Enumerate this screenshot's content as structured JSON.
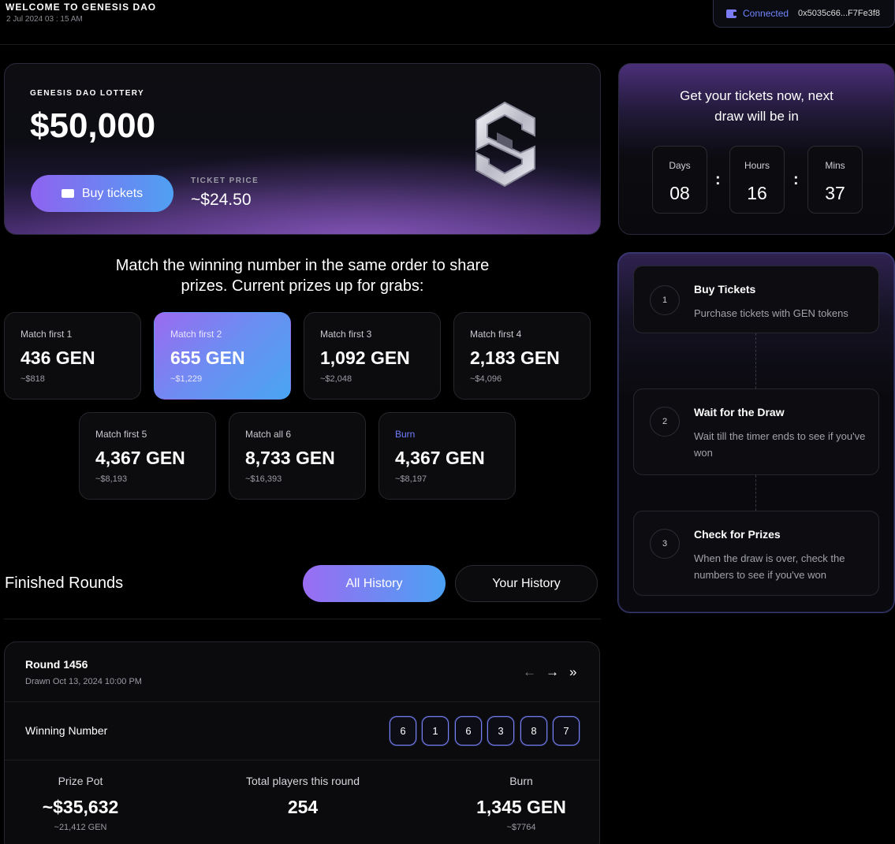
{
  "header": {
    "welcome": "WELCOME TO GENESIS DAO",
    "datetime": "2 Jul 2024  03 : 15 AM",
    "wallet_status": "Connected",
    "wallet_address": "0x5035c66...F7Fe3f8"
  },
  "hero": {
    "label": "GENESIS DAO LOTTERY",
    "amount": "$50,000",
    "buy_label": "Buy tickets",
    "ticket_price_label": "TICKET PRICE",
    "ticket_price": "~$24.50"
  },
  "countdown": {
    "title_line1": "Get your tickets now, next",
    "title_line2": "draw will be in",
    "days_label": "Days",
    "days": "08",
    "hours_label": "Hours",
    "hours": "16",
    "mins_label": "Mins",
    "mins": "37",
    "separator": ":"
  },
  "match": {
    "title_line1": "Match the winning number in the same order to share",
    "title_line2": "prizes. Current prizes up for grabs:"
  },
  "prizes": [
    {
      "label": "Match first 1",
      "value": "436 GEN",
      "usd": "~$818"
    },
    {
      "label": "Match first 2",
      "value": "655 GEN",
      "usd": "~$1,229"
    },
    {
      "label": "Match first 3",
      "value": "1,092 GEN",
      "usd": "~$2,048"
    },
    {
      "label": "Match first 4",
      "value": "2,183 GEN",
      "usd": "~$4,096"
    },
    {
      "label": "Match first 5",
      "value": "4,367 GEN",
      "usd": "~$8,193"
    },
    {
      "label": "Match all 6",
      "value": "8,733 GEN",
      "usd": "~$16,393"
    },
    {
      "label": "Burn",
      "value": "4,367 GEN",
      "usd": "~$8,197"
    }
  ],
  "steps": [
    {
      "num": "1",
      "title": "Buy Tickets",
      "desc": "Purchase tickets with GEN tokens"
    },
    {
      "num": "2",
      "title": "Wait for the Draw",
      "desc": "Wait till the timer ends to see if you've won"
    },
    {
      "num": "3",
      "title": "Check for Prizes",
      "desc": "When the draw is over, check the numbers to see if you've won"
    }
  ],
  "finished": {
    "title": "Finished Rounds",
    "tab_all": "All History",
    "tab_yours": "Your History"
  },
  "round": {
    "name": "Round 1456",
    "drawn": "Drawn Oct 13, 2024   10:00 PM",
    "nav_prev": "←",
    "nav_next": "→",
    "nav_last": "»",
    "winning_label": "Winning Number",
    "numbers": [
      "6",
      "1",
      "6",
      "3",
      "8",
      "7"
    ],
    "prize_pot_label": "Prize Pot",
    "prize_pot": "~$35,632",
    "prize_pot_gen": "~21,412 GEN",
    "players_label": "Total players this round",
    "players": "254",
    "burn_label": "Burn",
    "burn": "1,345 GEN",
    "burn_usd": "~$7764"
  }
}
